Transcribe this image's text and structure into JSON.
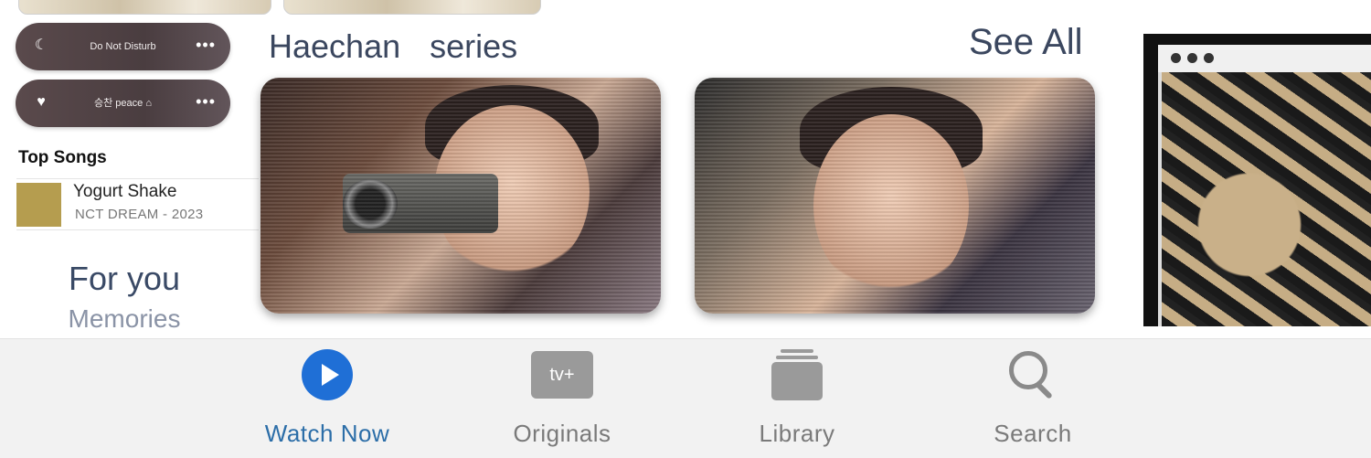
{
  "focus": [
    {
      "label": "Do Not Disturb",
      "icon": "moon-icon",
      "more": "•••"
    },
    {
      "label": "승찬 peace ⌂",
      "icon": "heart-icon",
      "more": "•••"
    }
  ],
  "top_songs": {
    "title": "Top Songs",
    "items": [
      {
        "title": "Yogurt Shake",
        "subtitle": "NCT DREAM - 2023",
        "art_color": "#b59d4f"
      }
    ]
  },
  "for_you": {
    "title": "For you",
    "subtitle": "Memories"
  },
  "section": {
    "title": "Haechan  series",
    "see_all": "See All"
  },
  "tabbar": {
    "tabs": [
      {
        "label": "Watch Now",
        "icon": "play-icon",
        "active": true
      },
      {
        "label": "Originals",
        "icon": "appletv-icon",
        "icon_text": "tv+",
        "active": false
      },
      {
        "label": "Library",
        "icon": "library-icon",
        "active": false
      },
      {
        "label": "Search",
        "icon": "search-icon",
        "active": false
      }
    ]
  },
  "colors": {
    "accent": "#1f6fd6",
    "active_label": "#2c6ea8",
    "inactive": "#7a7a7a"
  }
}
